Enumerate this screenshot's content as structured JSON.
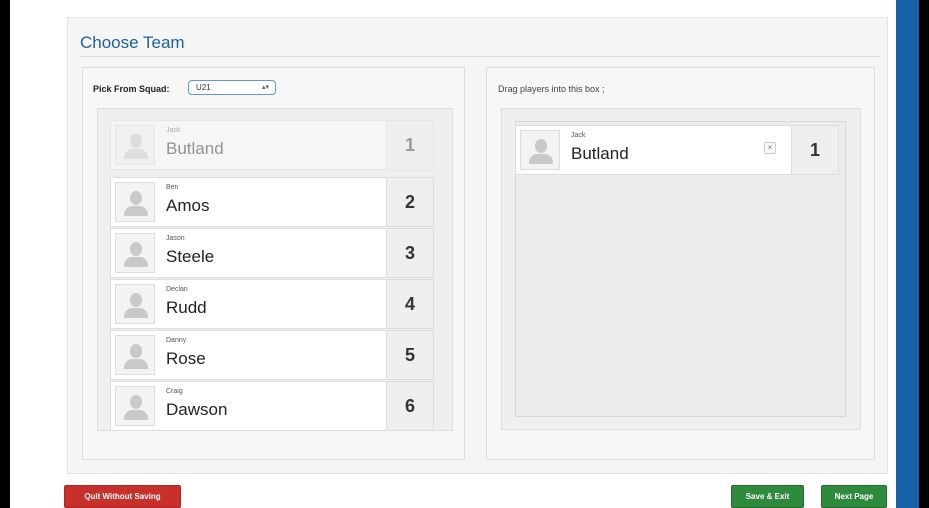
{
  "page": {
    "title": "Choose Team"
  },
  "squad": {
    "label": "Pick From Squad:",
    "selected": "U21"
  },
  "drop": {
    "hint": "Drag players into this box ;"
  },
  "players": [
    {
      "first": "Jack",
      "last": "Butland",
      "number": "1",
      "dimmed": true
    },
    {
      "first": "Ben",
      "last": "Amos",
      "number": "2"
    },
    {
      "first": "Jason",
      "last": "Steele",
      "number": "3"
    },
    {
      "first": "Declan",
      "last": "Rudd",
      "number": "4"
    },
    {
      "first": "Danny",
      "last": "Rose",
      "number": "5"
    },
    {
      "first": "Craig",
      "last": "Dawson",
      "number": "6"
    }
  ],
  "selected_players": [
    {
      "first": "Jack",
      "last": "Butland",
      "number": "1",
      "remove_symbol": "×"
    }
  ],
  "buttons": {
    "quit": "Quit Without Saving",
    "save": "Save & Exit",
    "next": "Next Page"
  },
  "colors": {
    "accent": "#1f5fa8",
    "danger": "#c9302c",
    "success": "#2e8b3d",
    "frame": "#1560a8"
  }
}
